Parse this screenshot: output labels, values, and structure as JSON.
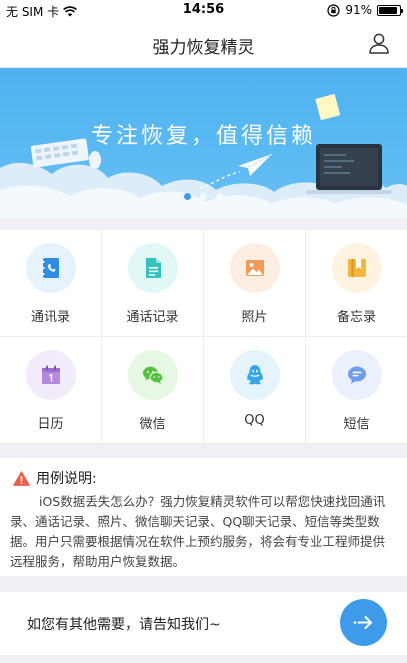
{
  "status_bar": {
    "carrier": "无 SIM 卡",
    "time": "14:56",
    "battery_text": "91%",
    "battery_level": 0.91
  },
  "header": {
    "title": "强力恢复精灵",
    "user_icon": "user-icon"
  },
  "banner": {
    "slogan": "专注恢复，值得信赖",
    "slide_count": 3,
    "active_slide": 1
  },
  "grid": {
    "items": [
      {
        "label": "通讯录",
        "icon": "contacts-book-icon",
        "color": "#2f8de4",
        "bg": "#e6f3fc"
      },
      {
        "label": "通话记录",
        "icon": "call-log-icon",
        "color": "#34c4c0",
        "bg": "#e2f8f6"
      },
      {
        "label": "照片",
        "icon": "photo-icon",
        "color": "#f39a57",
        "bg": "#fdeee4"
      },
      {
        "label": "备忘录",
        "icon": "memo-icon",
        "color": "#f3b83b",
        "bg": "#fdf3e0"
      },
      {
        "label": "日历",
        "icon": "calendar-icon",
        "color": "#b28bde",
        "bg": "#f2ecfa"
      },
      {
        "label": "微信",
        "icon": "wechat-icon",
        "color": "#52c13f",
        "bg": "#e6f8e3"
      },
      {
        "label": "QQ",
        "icon": "qq-icon",
        "color": "#35a7e8",
        "bg": "#e4f3fc"
      },
      {
        "label": "短信",
        "icon": "sms-icon",
        "color": "#6f9ceb",
        "bg": "#eaf0fc"
      }
    ]
  },
  "instructions": {
    "title": "用例说明:",
    "body": "iOS数据丢失怎么办？强力恢复精灵软件可以帮您快速找回通讯录、通话记录、照片、微信聊天记录、QQ聊天记录、短信等类型数据。用户只需要根据情况在软件上预约服务，将会有专业工程师提供远程服务，帮助用户恢复数据。",
    "warning_color": "#e8624f"
  },
  "contact": {
    "text": "如您有其他需要，请告知我们~",
    "button_color": "#3d9be9"
  }
}
